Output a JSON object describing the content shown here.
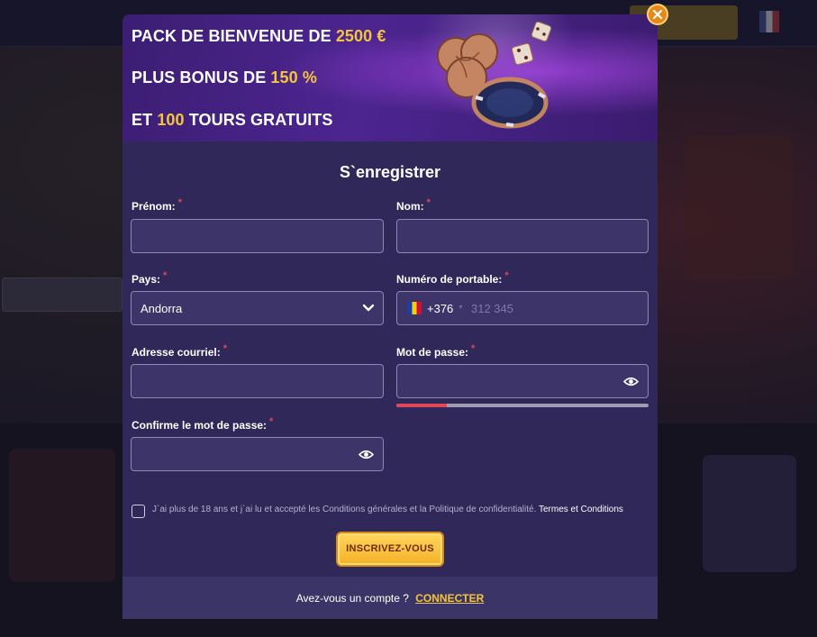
{
  "banner": {
    "line1_prefix": "PACK DE BIENVENUE DE ",
    "line1_highlight": "2500 €",
    "line2_prefix": "PLUS BONUS DE ",
    "line2_highlight": "150 %",
    "line3_prefix": "ET ",
    "line3_highlight": "100",
    "line3_suffix": " TOURS GRATUITS"
  },
  "form": {
    "title": "S`enregistrer",
    "required_mark": "*",
    "first_name_label": "Prénom:",
    "last_name_label": "Nom:",
    "country_label": "Pays:",
    "country_value": "Andorra",
    "phone_label": "Numéro de portable:",
    "phone_dial_code": "+376",
    "phone_placeholder": "312 345",
    "email_label": "Adresse courriel:",
    "password_label": "Mot de passe:",
    "password_strength": 0.2,
    "confirm_label": "Confirme le mot de passe:",
    "consent_text": "J`ai plus de 18 ans et j`ai lu et accepté les Conditions générales et la Politique de confidentialité.",
    "terms_link": "Termes et Conditions",
    "submit_label": "INSCRIVEZ-VOUS"
  },
  "footer": {
    "question": "Avez-vous un compte ?",
    "login_link": "CONNECTER"
  },
  "colors": {
    "modal_bg": "#2f2858",
    "field_bg": "#3d3569",
    "accent_gold": "#f4c53c",
    "required_red": "#e0455a"
  },
  "icons": [
    "close-icon",
    "chevron-down-icon",
    "eye-icon",
    "andorra-flag-icon",
    "casino-chips-illustration"
  ]
}
